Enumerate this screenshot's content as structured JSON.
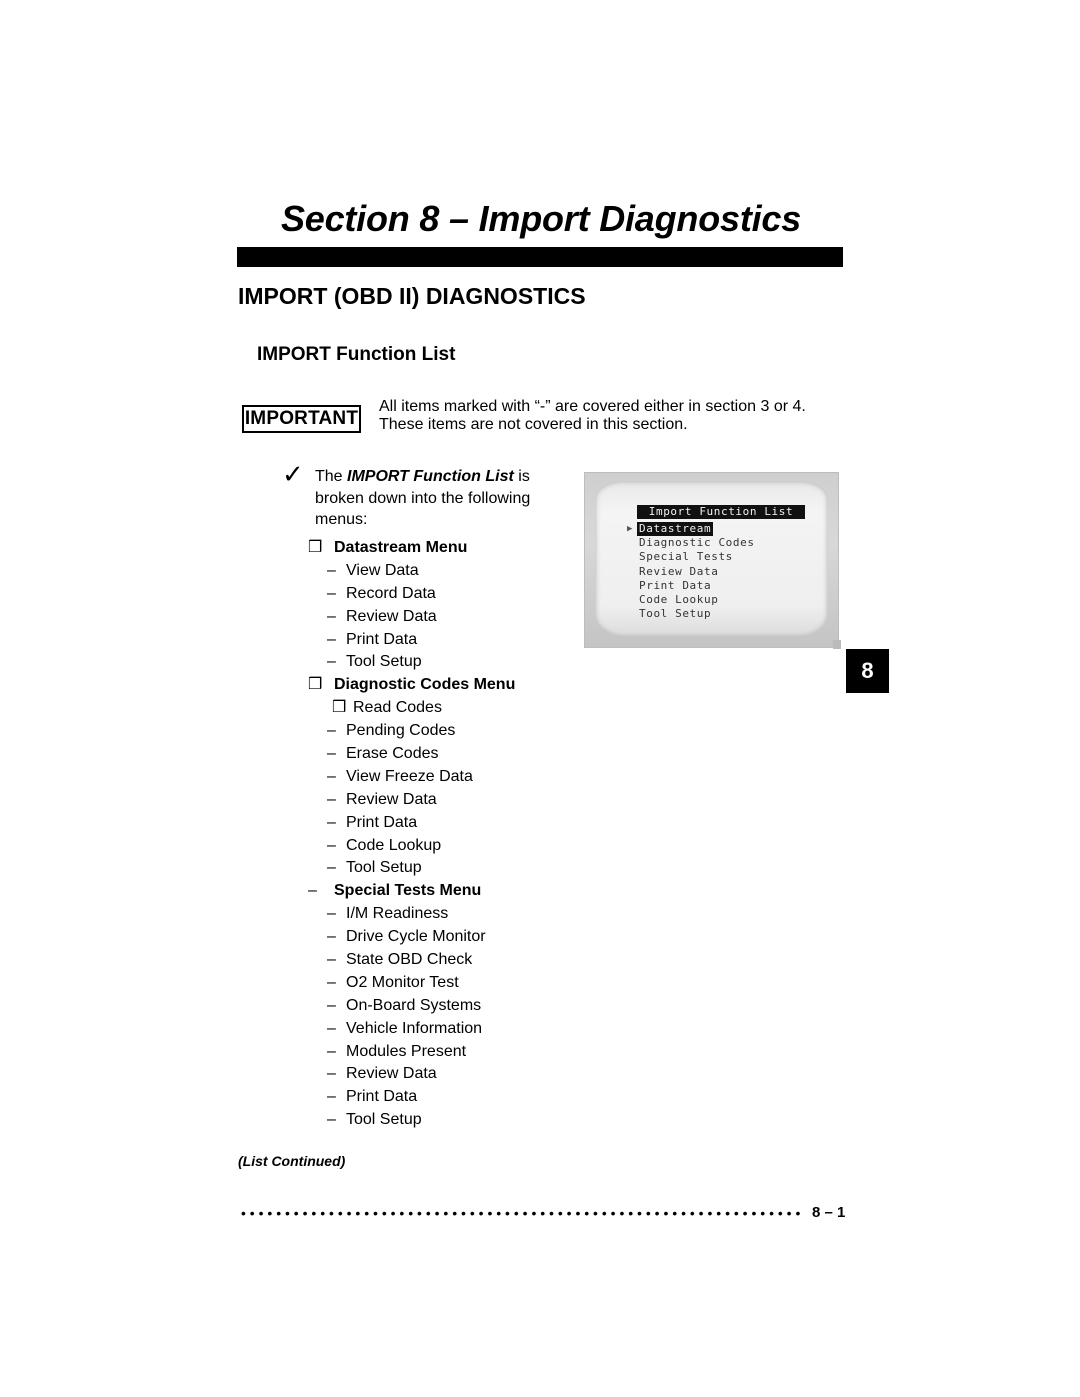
{
  "header": {
    "section_title": "Section 8 – Import Diagnostics",
    "heading": "IMPORT (OBD II) DIAGNOSTICS",
    "subheading": "IMPORT Function List"
  },
  "important": {
    "badge": "IMPORTANT",
    "line1": "All items marked with “-” are covered either in section 3 or 4.",
    "line2": "These items are not covered in this section."
  },
  "intro": {
    "check_icon": "✓",
    "prefix": "The ",
    "emphasis": "IMPORT Function List",
    "suffix": " is broken down into the following menus:"
  },
  "menus": [
    {
      "type": "menu",
      "mark": "❒",
      "label": "Datastream Menu"
    },
    {
      "type": "sub",
      "mark": "–",
      "label": "View Data"
    },
    {
      "type": "sub",
      "mark": "–",
      "label": "Record Data"
    },
    {
      "type": "sub",
      "mark": "–",
      "label": "Review Data"
    },
    {
      "type": "sub",
      "mark": "–",
      "label": "Print Data"
    },
    {
      "type": "sub",
      "mark": "–",
      "label": "Tool Setup"
    },
    {
      "type": "menu",
      "mark": "❒",
      "label": "Diagnostic Codes Menu"
    },
    {
      "type": "subbox",
      "mark": "❒",
      "label": "Read Codes"
    },
    {
      "type": "sub",
      "mark": "–",
      "label": "Pending Codes"
    },
    {
      "type": "sub",
      "mark": "–",
      "label": "Erase Codes"
    },
    {
      "type": "sub",
      "mark": "–",
      "label": "View Freeze Data"
    },
    {
      "type": "sub",
      "mark": "–",
      "label": "Review Data"
    },
    {
      "type": "sub",
      "mark": "–",
      "label": "Print Data"
    },
    {
      "type": "sub",
      "mark": "–",
      "label": "Code Lookup"
    },
    {
      "type": "sub",
      "mark": "–",
      "label": "Tool Setup"
    },
    {
      "type": "menu",
      "mark": "–",
      "label": "Special Tests Menu"
    },
    {
      "type": "sub",
      "mark": "–",
      "label": "I/M Readiness"
    },
    {
      "type": "sub",
      "mark": "–",
      "label": "Drive Cycle Monitor"
    },
    {
      "type": "sub",
      "mark": "–",
      "label": "State OBD Check"
    },
    {
      "type": "sub",
      "mark": "–",
      "label": "O2 Monitor Test"
    },
    {
      "type": "sub",
      "mark": "–",
      "label": "On-Board Systems"
    },
    {
      "type": "sub",
      "mark": "–",
      "label": "Vehicle Information"
    },
    {
      "type": "sub",
      "mark": "–",
      "label": "Modules Present"
    },
    {
      "type": "sub",
      "mark": "–",
      "label": "Review Data"
    },
    {
      "type": "sub",
      "mark": "–",
      "label": "Print Data"
    },
    {
      "type": "sub",
      "mark": "–",
      "label": "Tool Setup"
    }
  ],
  "screen": {
    "title": "Import Function List",
    "cursor_icon": "▶",
    "selected_index": 0,
    "items": [
      "Datastream",
      "Diagnostic Codes",
      "Special Tests",
      "Review Data",
      "Print Data",
      "Code Lookup",
      "Tool Setup"
    ]
  },
  "tab": {
    "label": "8"
  },
  "footer": {
    "list_continued": "(List Continued)",
    "dots": "••••••••••••••••••••••••••••••••••••••••••••••••••••••••••••••••",
    "page_number": "8 – 1"
  }
}
